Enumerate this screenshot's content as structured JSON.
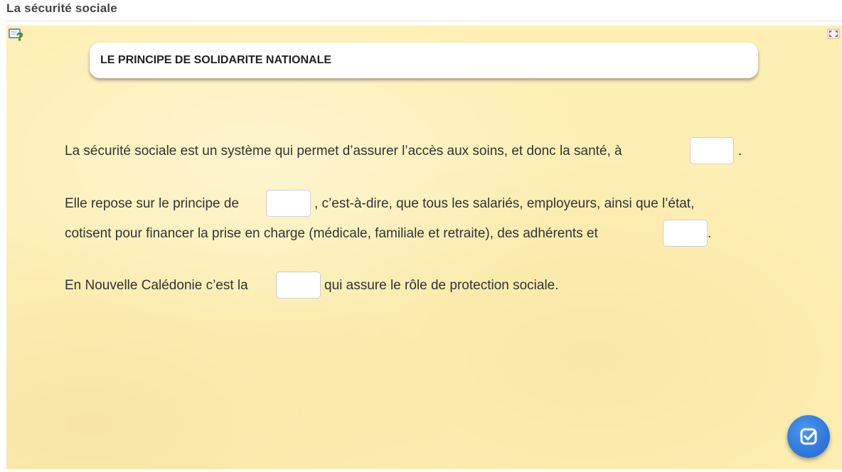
{
  "page": {
    "title": "La sécurité sociale"
  },
  "activity": {
    "header_title": "LE PRINCIPE DE SOLIDARITE NATIONALE",
    "paragraphs": {
      "p1_before": "La sécurité sociale est un système qui permet d’assurer l’accès aux soins, et donc la santé, à",
      "p1_after": ".",
      "p2_before": "Elle repose sur le principe de",
      "p2_after": ", c’est-à-dire, que tous les salariés, employeurs, ainsi que l’état,",
      "p3_before": "cotisent pour financer la prise en charge (médicale, familiale et retraite), des adhérents et",
      "p3_after": ".",
      "p4_before": "En Nouvelle Calédonie c’est la",
      "p4_after": "qui assure le rôle de protection sociale."
    },
    "blanks": [
      "",
      "",
      "",
      ""
    ]
  },
  "icons": {
    "help": "help-question-icon",
    "fullscreen": "fullscreen-icon",
    "check": "check-icon"
  },
  "colors": {
    "background": "#fdefb4",
    "check_button": "#2f79db"
  }
}
